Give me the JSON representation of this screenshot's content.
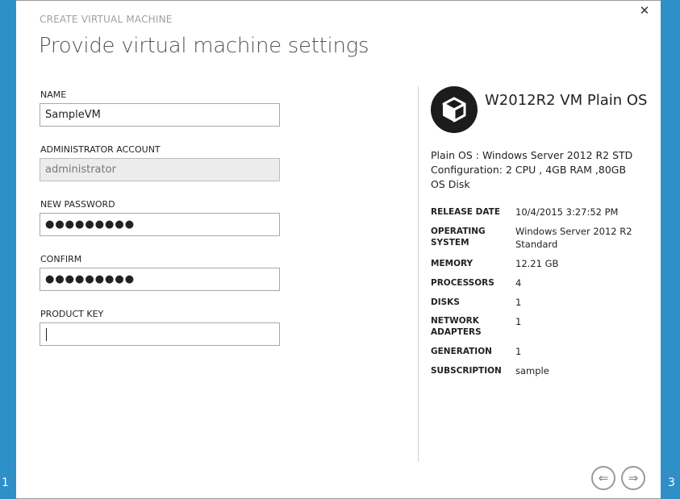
{
  "wizard": {
    "label": "CREATE VIRTUAL MACHINE",
    "title": "Provide virtual machine settings",
    "current_step": "1",
    "next_step": "3"
  },
  "form": {
    "name": {
      "label": "NAME",
      "value": "SampleVM"
    },
    "admin": {
      "label": "ADMINISTRATOR ACCOUNT",
      "value": "administrator"
    },
    "password": {
      "label": "NEW PASSWORD",
      "value": "●●●●●●●●●"
    },
    "confirm": {
      "label": "CONFIRM",
      "value": "●●●●●●●●●"
    },
    "product_key": {
      "label": "PRODUCT KEY",
      "value": ""
    }
  },
  "vm": {
    "icon": "cube-icon",
    "title": "W2012R2 VM Plain OS",
    "description": "Plain OS : Windows Server 2012 R2 STD Configuration: 2 CPU , 4GB RAM ,80GB OS Disk",
    "specs": [
      {
        "key": "RELEASE DATE",
        "value": "10/4/2015 3:27:52 PM"
      },
      {
        "key": "OPERATING SYSTEM",
        "value": "Windows Server 2012 R2 Standard"
      },
      {
        "key": "MEMORY",
        "value": "12.21 GB"
      },
      {
        "key": "PROCESSORS",
        "value": "4"
      },
      {
        "key": "DISKS",
        "value": "1"
      },
      {
        "key": "NETWORK ADAPTERS",
        "value": "1"
      },
      {
        "key": "GENERATION",
        "value": "1"
      },
      {
        "key": "SUBSCRIPTION",
        "value": "sample"
      }
    ]
  },
  "nav": {
    "close_glyph": "✕",
    "back_glyph": "⇐",
    "next_glyph": "⇒"
  },
  "colors": {
    "accent": "#2f8fc7"
  }
}
